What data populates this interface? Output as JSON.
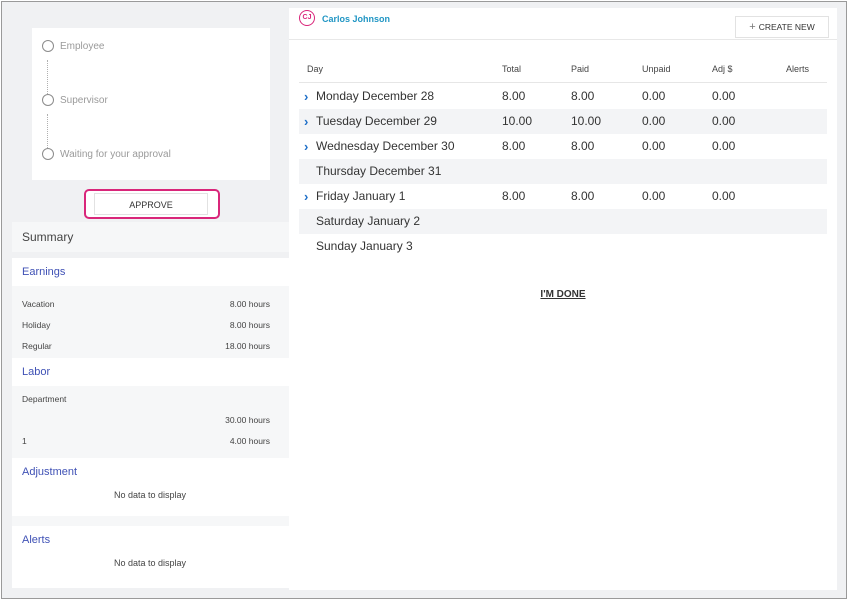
{
  "approval": {
    "steps": [
      "Employee",
      "Supervisor",
      "Waiting for your approval"
    ],
    "approve_label": "APPROVE"
  },
  "summary": {
    "title": "Summary",
    "earnings": {
      "title": "Earnings",
      "rows": [
        {
          "label": "Vacation",
          "value": "8.00 hours"
        },
        {
          "label": "Holiday",
          "value": "8.00 hours"
        },
        {
          "label": "Regular",
          "value": "18.00 hours"
        }
      ]
    },
    "labor": {
      "title": "Labor",
      "rows": [
        {
          "label": "Department",
          "value": ""
        },
        {
          "label": "",
          "value": "30.00 hours"
        },
        {
          "label": "1",
          "value": "4.00 hours"
        }
      ]
    },
    "adjustment": {
      "title": "Adjustment",
      "empty_text": "No data to display"
    },
    "alerts": {
      "title": "Alerts",
      "empty_text": "No data to display"
    }
  },
  "header": {
    "initials": "CJ",
    "user_name": "Carlos Johnson",
    "create_label": "CREATE NEW",
    "brand_color": "#d9267a",
    "link_color": "#2196c4"
  },
  "table": {
    "columns": [
      "Day",
      "Total",
      "Paid",
      "Unpaid",
      "Adj $",
      "Alerts"
    ],
    "rows": [
      {
        "day": "Monday December 28",
        "total": "8.00",
        "paid": "8.00",
        "unpaid": "0.00",
        "adj": "0.00",
        "alerts": "",
        "expandable": true
      },
      {
        "day": "Tuesday December 29",
        "total": "10.00",
        "paid": "10.00",
        "unpaid": "0.00",
        "adj": "0.00",
        "alerts": "",
        "expandable": true
      },
      {
        "day": "Wednesday December 30",
        "total": "8.00",
        "paid": "8.00",
        "unpaid": "0.00",
        "adj": "0.00",
        "alerts": "",
        "expandable": true
      },
      {
        "day": "Thursday December 31",
        "total": "",
        "paid": "",
        "unpaid": "",
        "adj": "",
        "alerts": "",
        "expandable": false
      },
      {
        "day": "Friday January 1",
        "total": "8.00",
        "paid": "8.00",
        "unpaid": "0.00",
        "adj": "0.00",
        "alerts": "",
        "expandable": true
      },
      {
        "day": "Saturday January 2",
        "total": "",
        "paid": "",
        "unpaid": "",
        "adj": "",
        "alerts": "",
        "expandable": false
      },
      {
        "day": "Sunday January 3",
        "total": "",
        "paid": "",
        "unpaid": "",
        "adj": "",
        "alerts": "",
        "expandable": false
      }
    ]
  },
  "done_label": "I'M DONE"
}
